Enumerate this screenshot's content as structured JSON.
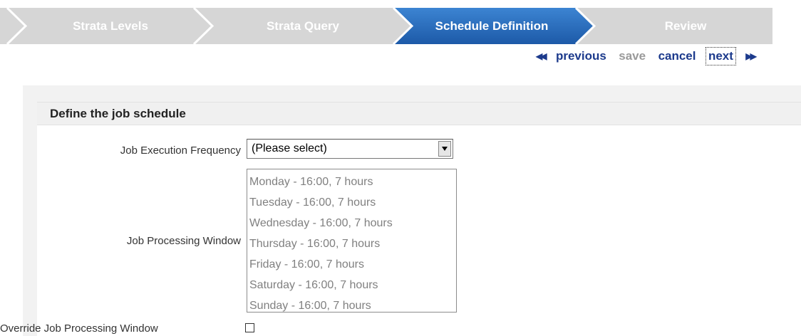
{
  "wizard": {
    "steps": [
      {
        "label": "Strata Levels",
        "active": false
      },
      {
        "label": "Strata Query",
        "active": false
      },
      {
        "label": "Schedule Definition",
        "active": true
      },
      {
        "label": "Review",
        "active": false
      }
    ],
    "colors": {
      "inactive_bg": "#d6d6d6",
      "active_bg": "#2a6fc0",
      "chevron_light": "#ffffff"
    }
  },
  "nav": {
    "previous_arrow": "◀◀",
    "previous": "previous",
    "save": "save",
    "cancel": "cancel",
    "next": "next",
    "next_arrow": "▶▶"
  },
  "section": {
    "title": "Define the job schedule"
  },
  "form": {
    "frequency_label": "Job Execution Frequency",
    "frequency_value": "(Please select)",
    "window_label": "Job Processing Window",
    "window_options": [
      "Monday - 16:00, 7 hours",
      "Tuesday - 16:00, 7 hours",
      "Wednesday - 16:00, 7 hours",
      "Thursday - 16:00, 7 hours",
      "Friday - 16:00, 7 hours",
      "Saturday - 16:00, 7 hours",
      "Sunday - 16:00, 7 hours"
    ],
    "override_label": "Override Job Processing Window",
    "override_checked": false
  }
}
